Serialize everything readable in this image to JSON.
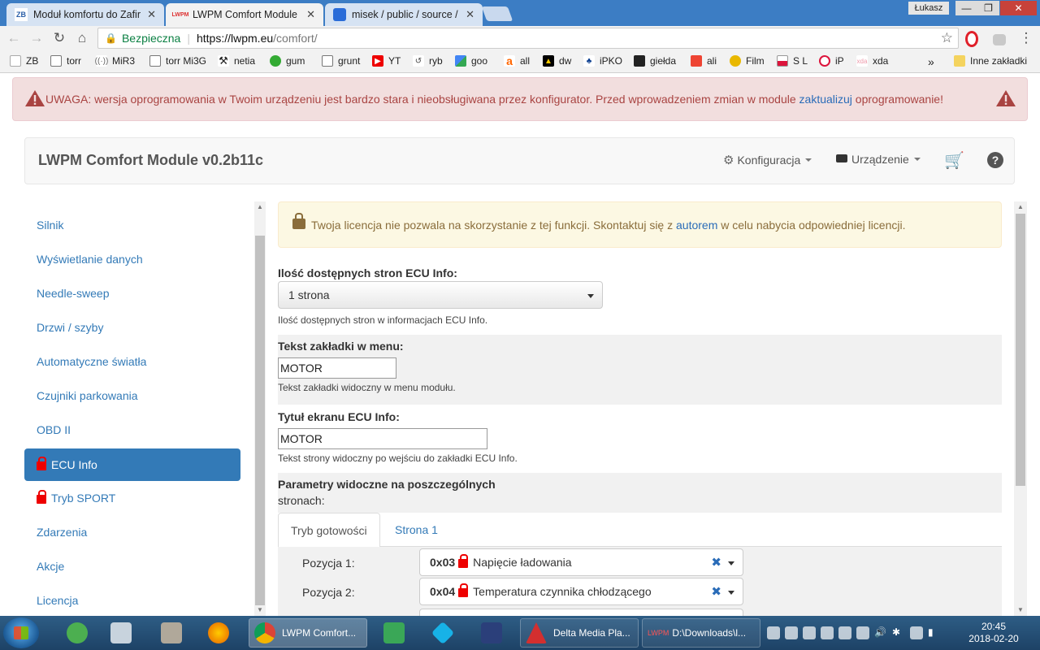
{
  "browser": {
    "tabs": [
      {
        "title": "Moduł komfortu do Zafir",
        "favicon": "ZB"
      },
      {
        "title": "LWPM Comfort Module",
        "favicon": "LWPM"
      },
      {
        "title": "misek / public / source /",
        "favicon": "bitbucket-icon"
      }
    ],
    "user": "Łukasz",
    "address": {
      "secure_label": "Bezpieczna",
      "separator": "|",
      "host": "https://lwpm.eu",
      "path": "/comfort/"
    },
    "bookmarks": [
      "ZB",
      "torr",
      "MiR3",
      "torr Mi3G",
      "netia",
      "gum",
      "grunt",
      "YT",
      "ryb",
      "goo",
      "all",
      "dw",
      "iPKO",
      "giełda",
      "ali",
      "Film",
      "S L",
      "iP",
      "xda"
    ],
    "bookmarks_more": "»",
    "bookmarks_other": "Inne zakładki"
  },
  "page": {
    "alert": {
      "before": "UWAGA: wersja oprogramowania w Twoim urządzeniu jest bardzo stara i nieobsługiwana przez konfigurator. Przed wprowadzeniem zmian w module ",
      "link": "zaktualizuj",
      "after": " oprogramowanie!"
    },
    "brand": "LWPM Comfort Module v0.2b11c",
    "nav": {
      "config": "Konfiguracja",
      "device": "Urządzenie"
    },
    "sidebar": [
      {
        "label": "Silnik",
        "locked": false,
        "active": false
      },
      {
        "label": "Wyświetlanie danych",
        "locked": false,
        "active": false
      },
      {
        "label": "Needle-sweep",
        "locked": false,
        "active": false
      },
      {
        "label": "Drzwi / szyby",
        "locked": false,
        "active": false
      },
      {
        "label": "Automatyczne światła",
        "locked": false,
        "active": false
      },
      {
        "label": "Czujniki parkowania",
        "locked": false,
        "active": false
      },
      {
        "label": "OBD II",
        "locked": false,
        "active": false
      },
      {
        "label": "ECU Info",
        "locked": true,
        "active": true
      },
      {
        "label": "Tryb SPORT",
        "locked": true,
        "active": false
      },
      {
        "label": "Zdarzenia",
        "locked": false,
        "active": false
      },
      {
        "label": "Akcje",
        "locked": false,
        "active": false
      },
      {
        "label": "Licencja",
        "locked": false,
        "active": false
      }
    ],
    "license_alert": {
      "before": "Twoja licencja nie pozwala na skorzystanie z tej funkcji. Skontaktuj się z ",
      "link": "autorem",
      "after": " w celu nabycia odpowiedniej licencji."
    },
    "pages_count": {
      "label": "Ilość dostępnych stron ECU Info:",
      "value": "1 strona",
      "help": "Ilość dostępnych stron w informacjach ECU Info."
    },
    "menu_tab_text": {
      "label": "Tekst zakładki w menu:",
      "value": "MOTOR",
      "help": "Tekst zakładki widoczny w menu modułu."
    },
    "screen_title": {
      "label": "Tytuł ekranu ECU Info:",
      "value": "MOTOR",
      "help": "Tekst strony widoczny po wejściu do zakładki ECU Info."
    },
    "params": {
      "label_line1": "Parametry widoczne na poszczególnych",
      "label_line2": "stronach:",
      "tabs": [
        "Tryb gotowości",
        "Strona 1"
      ],
      "positions": [
        {
          "label": "Pozycja 1:",
          "code": "0x03",
          "name": "Napięcie ładowania"
        },
        {
          "label": "Pozycja 2:",
          "code": "0x04",
          "name": "Temperatura czynnika chłodzącego"
        }
      ]
    }
  },
  "taskbar": {
    "tasks": [
      "LWPM Comfort...",
      "Delta Media Pla...",
      "D:\\Downloads\\l..."
    ],
    "task_prefix_3": "LWPM",
    "time": "20:45",
    "date": "2018-02-20"
  },
  "colors": {
    "tabstrip": "#3c7dc4",
    "link": "#337ab7",
    "danger_bg": "#f2dede",
    "danger_text": "#a94442",
    "warning_bg": "#fcf8e3",
    "warning_text": "#8a6d3b",
    "lock_red": "#e00000"
  }
}
